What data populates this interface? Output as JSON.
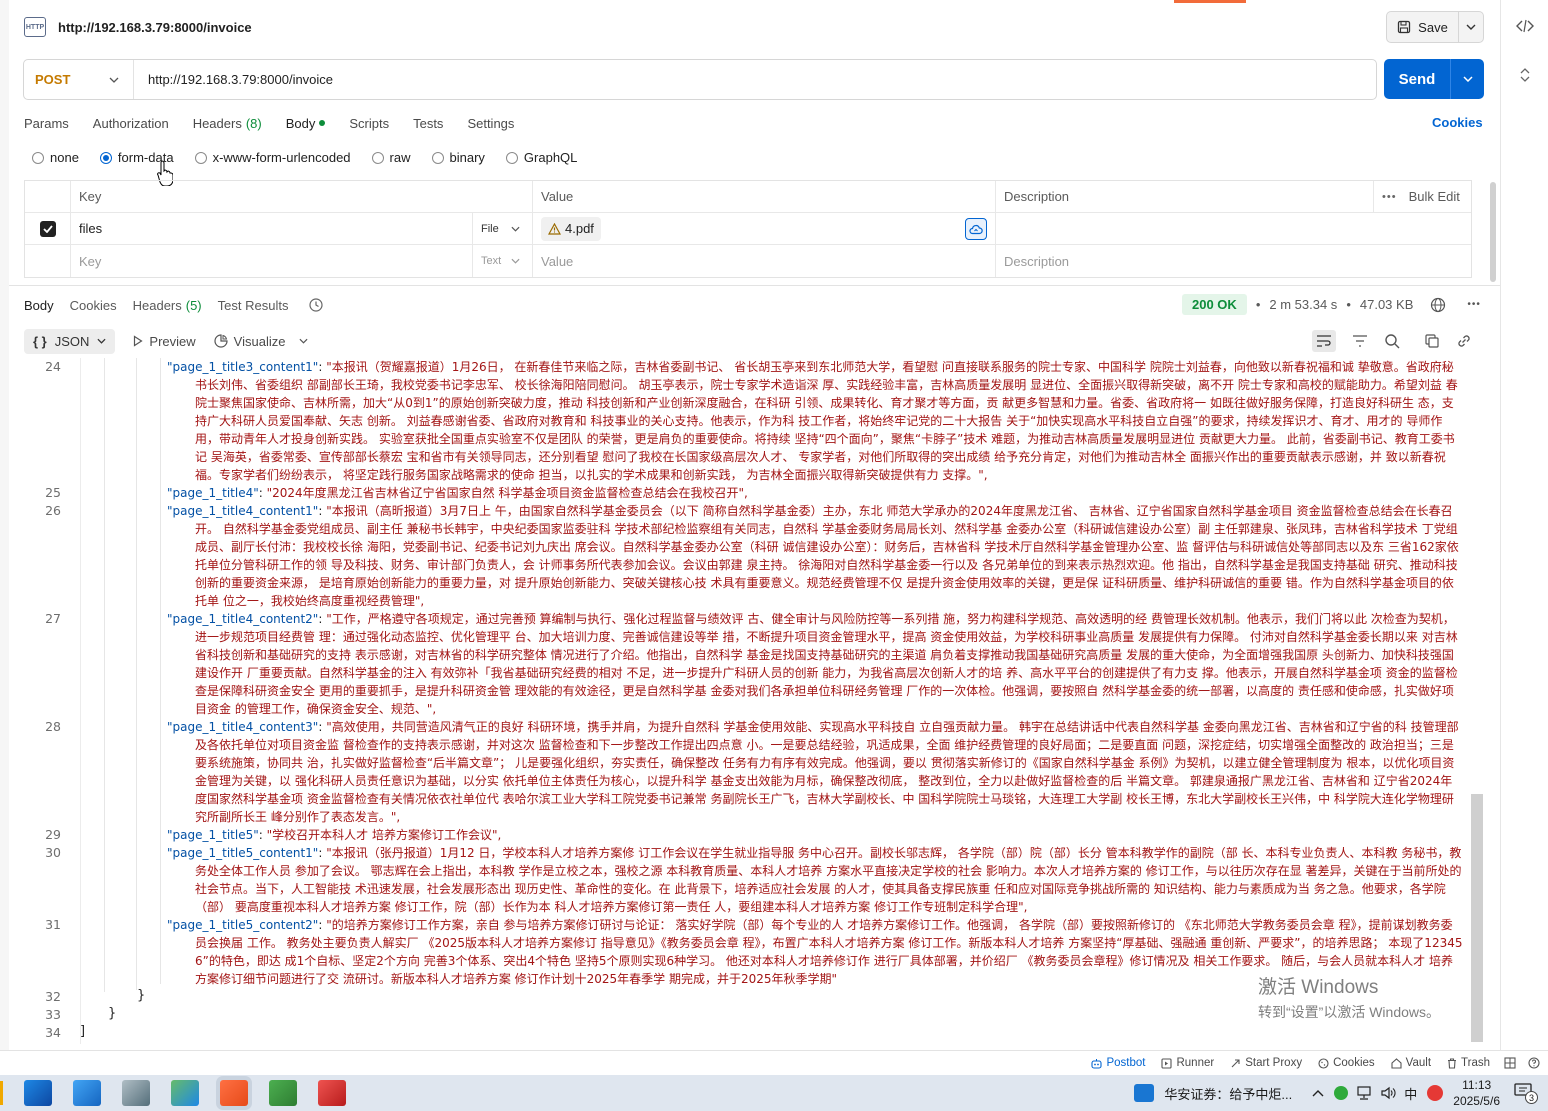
{
  "request": {
    "title": "http://192.168.3.79:8000/invoice",
    "method": "POST",
    "url": "http://192.168.3.79:8000/invoice",
    "save_label": "Save",
    "send_label": "Send"
  },
  "req_tabs": [
    {
      "label": "Params"
    },
    {
      "label": "Authorization"
    },
    {
      "label": "Headers",
      "count": "(8)"
    },
    {
      "label": "Body"
    },
    {
      "label": "Scripts"
    },
    {
      "label": "Tests"
    },
    {
      "label": "Settings"
    }
  ],
  "cookies_label": "Cookies",
  "body_types": [
    "none",
    "form-data",
    "x-www-form-urlencoded",
    "raw",
    "binary",
    "GraphQL"
  ],
  "table": {
    "headers": {
      "key": "Key",
      "value": "Value",
      "description": "Description",
      "bulk_edit": "Bulk Edit"
    },
    "row": {
      "key": "files",
      "type": "File",
      "value": "4.pdf"
    },
    "empty": {
      "key": "Key",
      "type": "Text",
      "value": "Value",
      "description": "Description"
    }
  },
  "resp_tabs": [
    {
      "label": "Body"
    },
    {
      "label": "Cookies"
    },
    {
      "label": "Headers",
      "count": "(5)"
    },
    {
      "label": "Test Results"
    }
  ],
  "status": {
    "code": "200 OK",
    "time": "2 m 53.34 s",
    "size": "47.03 KB"
  },
  "viewer": {
    "format": "JSON",
    "preview": "Preview",
    "visualize": "Visualize"
  },
  "code_lines": [
    {
      "n": "24",
      "key": "\"page_1_title3_content1\"",
      "val": "\"本报讯（贺耀嘉报道）1月26日， 在新春佳节来临之际，吉林省委副书记、 省长胡玉亭来到东北师范大学，看望慰 问直接联系服务的院士专家、中国科学 院院士刘益春，向他致以新春祝福和诚 挚敬意。省政府秘书长刘伟、省委组织 部副部长王琦，我校党委书记李忠军、 校长徐海阳陪同慰问。 胡玉亭表示，院士专家学术造诣深 厚、实践经验丰富，吉林高质量发展明 显进位、全面振兴取得新突破，离不开 院士专家和高校的赋能助力。希望刘益 春院士聚焦国家使命、吉林所需，加大“从0到1”的原始创新突破力度，推动 科技创新和产业创新深度融合，在科研 引领、成果转化、育才聚才等方面，贡 献更多智慧和力量。省委、省政府将一 如既往做好服务保障，打造良好科研生 态，支持广大科研人员爱国奉献、矢志 创新。 刘益春感谢省委、省政府对教育和 科技事业的关心支持。他表示，作为科 技工作者，将始终牢记党的二十大报告 关于“加快实现高水平科技自立自强”的要求，持续发挥识才、育才、用才的 导师作用，带动青年人才投身创新实践。 实验室获批全国重点实验室不仅是团队 的荣誉，更是肩负的重要使命。将持续 坚持“四个面向”，聚焦“卡脖子”技术 难题，为推动吉林高质量发展明显进位 贡献更大力量。 此前，省委副书记、教育工委书记 吴海英，省委常委、宣传部部长蔡宏 宝和省市有关领导同志，还分别看望 慰问了我校在长国家级高层次人才、 专家学者，对他们所取得的突出成绩 给予充分肯定，对他们为推动吉林全 面振兴作出的重要贡献表示感谢，并 致以新春祝福。专家学者们纷纷表示， 将坚定践行服务国家战略需求的使命 担当，以扎实的学术成果和创新实践， 为吉林全面振兴取得新突破提供有力 支撑。\","
    },
    {
      "n": "25",
      "key": "\"page_1_title4\"",
      "val": "\"2024年度黑龙江省吉林省辽宁省国家自然 科学基金项目资金监督检查总结会在我校召开\","
    },
    {
      "n": "26",
      "key": "\"page_1_title4_content1\"",
      "val": "\"本报讯（高昕报道）3月7日上 午，由国家自然科学基金委员会（以下 简称自然科学基金委）主办，东北 师范大学承办的2024年度黑龙江省、 吉林省、辽宁省国家自然科学基金项目 资金监督检查总结会在长春召开。 自然科学基金委党组成员、副主任 兼秘书长韩宇，中央纪委国家监委驻科 学技术部纪检监察组有关同志，自然科 学基金委财务局局长刘、然科学基 金委办公室（科研诚信建设办公室）副 主任郭建泉、张凤玮，吉林省科学技术 丁党组成员、副厅长付沛：我校校长徐 海阳，党委副书记、纪委书记刘九庆出 席会议。自然科学基金委办公室（科研 诚信建设办公室）：财务后，吉林省科 学技术厅自然科学基金管理办公室、监 督评估与科研诚信处等部同志以及东 三省162家依托单位分管科研工作的领 导及科技、财务、审计部门负责人，会 计师事务所代表参加会议。会议由郭建 泉主持。 徐海阳对自然科学基金委一行以及 各兄弟单位的到来表示热烈欢迎。他 指出，自然科学基金是我国支持基础 研究、推动科技创新的重要资金来源， 是培育原始创新能力的重要力量，对 提升原始创新能力、突破关键核心技 术具有重要意义。规范经费管理不仅 是提升资金使用效率的关键，更是保 证科研质量、维护科研诚信的重要 错。作为自然科学基金项目的依托单 位之一，我校始终高度重视经费管理\","
    },
    {
      "n": "27",
      "key": "\"page_1_title4_content2\"",
      "val": "\"工作，严格遵守各项规定，通过完善预 算编制与执行、强化过程监督与绩效评 古、健全审计与风险防控等一系列措 施，努力构建科学规范、高效透明的经 费管理长效机制。他表示，我们门将以此 次检查为契机，进一步规范项目经费管 理：通过强化动态监控、优化管理平 台、加大培训力度、完善诚信建设等举 措，不断提升项目资金管理水平，提高 资金使用效益，为学校科研事业高质量 发展提供有力保障。 付沛对自然科学基金委长期以来 对吉林省科技创新和基础研究的支持 表示感谢，对吉林省的科学研究整体 情况进行了介绍。他指出，自然科学 基金是找国支持基础研究的主渠道 肩负着支撑推动我国基础研究高质量 发展的重大使命，为全面增强我国原 头创新力、加快科技强国建设作开 厂重要贡献。自然科学基金的注入 有效弥补「我省基础研究经费的相对 不足，进一步提升广科研人员的创新 能力，为我省高层次创新人才的培 养、高水平平台的创建提供了有力支 撑。他表示，开展自然科学基金项 资金的监督检查是保障科研资金安全 更用的重要抓手，是提升科研资金管 理效能的有效途径，更是自然科学基 金委对我们各承担单位科研经务管理 厂作的一次体检。他强调，要按照自 然科学基金委的统一部署，以高度的 责任感和使命感，扎实做好项目资金 的管理工作，确保资金安全、规范、\","
    },
    {
      "n": "28",
      "key": "\"page_1_title4_content3\"",
      "val": "\"高效使用，共同营造风清气正的良好 科研环境，携手并肩，为提升自然科 学基金使用效能、实现高水平科技自 立自强贡献力量。 韩宇在总结讲话中代表自然科学基 金委向黑龙江省、吉林省和辽宁省的科 技管理部及各依托单位对项目资金监 督检查作的支持表示感谢，并对这次 监督检查和下一步整改工作提出四点意 小。一是要总结经验，巩适成果，全面 维护经费管理的良好局面；二是要直面 问题，深挖症结，切实增强全面整改的 政治担当；三是要系统施策，协同共 治，扎实做好监督检查“后半篇文章”； 儿是要强化组织，夯实责任，确保整改 任务有力有序有效完成。他强调，要以 贯彻落实新修订的《国家自然科学基金 系例》为契机，以建立健全管理制度为 根本，以优化项目资金管理为关键，以 强化科研人员责任意识为基础，以分实 依托单位主体责任为核心，以提升科学 基金支出效能为月标，确保整改彻底， 整改到位，全力以赴做好监督检查的后 半篇文章。 郭建泉通报广黑龙江省、吉林省和 辽宁省2024年度国家然科学基金项 资金监督检查有关情况依衣社单位代 表哈尔滨工业大学科工院党委书记兼常 务副院长王广飞，吉林大学副校长、中 国科学院院士马琰铭，大连理工大学副 校长王博，东北大学副校长王兴伟，中 科学院大连化学物理研究所副所长王 峰分别作了表态发言。\","
    },
    {
      "n": "29",
      "key": "\"page_1_title5\"",
      "val": "\"学校召开本科人才 培养方案修订工作会议\","
    },
    {
      "n": "30",
      "key": "\"page_1_title5_content1\"",
      "val": "\"本报讯（张丹报道）1月12 日，学校本科人才培养方案修 订工作会议在学生就业指导服 务中心召开。副校长邬志辉， 各学院（部）院（部）长分 管本科教学作的副院（部 长、本科专业负责人、本科教 务秘书，教务处全体工作人员 参加了会议。 鄂志辉在会上指出，本科教 学作是立校之本，强校之源 本科教育质量、本科人才培养 方案水平直接决定学校的社会 影响力。本次人才培养方案的 修订工作，与以往历次存在显 著差异，关键在于当前所处的 社会节点。当下，人工智能技 术迅速发展，社会发展形态出 现历史性、革命性的变化。在 此背景下，培养适应社会发展 的人才，使其具备支撑民族重 任和应对国际竞争挑战所需的 知识结构、能力与素质成为当 务之急。他要求，各学院（部） 要高度重视本科人才培养方案 修订工作，院（部）长作为本 科人才培养方案修订第一责任 人，要组建本科人才培养方案 修订工作专班制定科学合理\","
    },
    {
      "n": "31",
      "key": "\"page_1_title5_content2\"",
      "val": "\"的培养方案修订工作方案，亲自 参与培养方案修订研讨与论证： 落实好学院（部）每个专业的人 才培养方案修订工作。他强调， 各学院（部）要按照新修订的 《东北师范大学教务委员会章 程》，提前谋划教务委员会换届 工作。 教务处主要负责人解实厂 《2025版本科人才培养方案修订 指导意见》《教务委员会章 程》，布置广本科人才培养方案 修订工作。新版本科人才培养 方案坚持“厚基础、强融通 重创新、严要求”，的培养思路； 本现了123456”的特色，即达 成1个自标、坚定2个方向 完善3个体系、突出4个特色 坚持5个原则实现6种学习。 他还对本科人才培养修订作 进行厂具体部署，并价绍厂 《教务委员会章程》修订情况及 相关工作要求。 随后，与会人员就本科人才 培养方案修订细节问题进行了交 流研讨。新版本科人才培养方案 修订作计划十2025年春季学 期完成，并于2025年秋季学期\""
    }
  ],
  "closing_lines": [
    {
      "n": "32",
      "text": "}"
    },
    {
      "n": "33",
      "text": "}"
    },
    {
      "n": "34",
      "text": "]"
    }
  ],
  "watermark": {
    "line1": "激活 Windows",
    "line2": "转到“设置”以激活 Windows。"
  },
  "footer": [
    "Postbot",
    "Runner",
    "Start Proxy",
    "Cookies",
    "Vault",
    "Trash"
  ],
  "taskbar": {
    "news": "华安证券：给予中炬...",
    "ime": "中",
    "time": "11:13",
    "date": "2025/5/6",
    "notif": "3"
  },
  "colors": {
    "accent": "#0265d2",
    "method": "#c57a00",
    "json_key": "#0451a5",
    "json_string": "#a31515",
    "ok_green": "#0d8d3a"
  }
}
